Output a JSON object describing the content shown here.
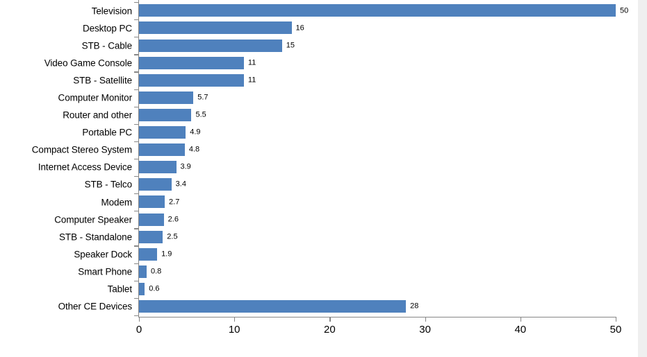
{
  "chart_data": {
    "type": "bar",
    "orientation": "horizontal",
    "title": "",
    "subtitle": "",
    "xlabel": "",
    "ylabel": "",
    "xlim": [
      0,
      50
    ],
    "xticks": [
      0,
      10,
      20,
      30,
      40,
      50
    ],
    "xtick_labels": [
      "0",
      "10",
      "20",
      "30",
      "40",
      "50"
    ],
    "grid": false,
    "legend": false,
    "bar_color": "#4f81bd",
    "axis_color": "#868686",
    "text_color": "#000000",
    "categories": [
      "Television",
      "Desktop PC",
      "STB - Cable",
      "Video Game Console",
      "STB - Satellite",
      "Computer Monitor",
      "Router and other",
      "Portable PC",
      "Compact Stereo System",
      "Internet Access Device",
      "STB - Telco",
      "Modem",
      "Computer Speaker",
      "STB - Standalone",
      "Speaker Dock",
      "Smart Phone",
      "Tablet",
      "Other CE Devices"
    ],
    "values": [
      50,
      16,
      15,
      11,
      11,
      5.7,
      5.5,
      4.9,
      4.8,
      3.9,
      3.4,
      2.7,
      2.6,
      2.5,
      1.9,
      0.8,
      0.6,
      28
    ],
    "value_labels": [
      "50",
      "16",
      "15",
      "11",
      "11",
      "5.7",
      "5.5",
      "4.9",
      "4.8",
      "3.9",
      "3.4",
      "2.7",
      "2.6",
      "2.5",
      "1.9",
      "0.8",
      "0.6",
      "28"
    ]
  }
}
